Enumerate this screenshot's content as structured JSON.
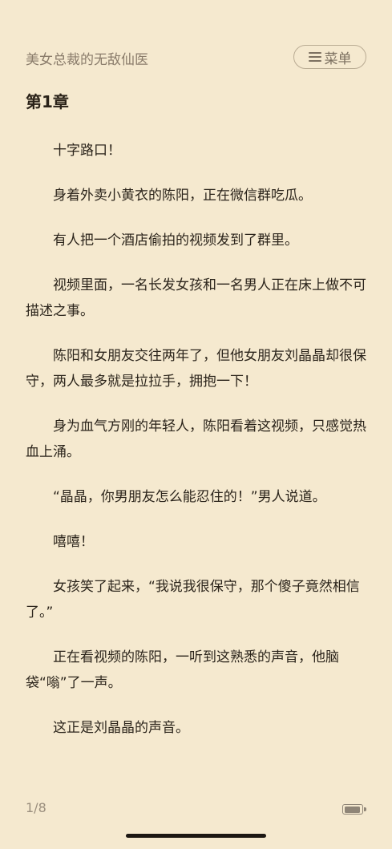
{
  "header": {
    "book_title": "美女总裁的无敌仙医",
    "menu_label": "菜单",
    "menu_icon": "list-menu-icon"
  },
  "chapter": {
    "title": "第1章"
  },
  "paragraphs": [
    "十字路口！",
    "身着外卖小黄衣的陈阳，正在微信群吃瓜。",
    "有人把一个酒店偷拍的视频发到了群里。",
    "视频里面，一名长发女孩和一名男人正在床上做不可描述之事。",
    "陈阳和女朋友交往两年了，但他女朋友刘晶晶却很保守，两人最多就是拉拉手，拥抱一下！",
    "身为血气方刚的年轻人，陈阳看着这视频，只感觉热血上涌。",
    "“晶晶，你男朋友怎么能忍住的！”男人说道。",
    "嘻嘻！",
    "女孩笑了起来，“我说我很保守，那个傻子竟然相信了。”",
    "正在看视频的陈阳，一听到这熟悉的声音，他脑袋“嗡”了一声。",
    "这正是刘晶晶的声音。"
  ],
  "footer": {
    "page_indicator": "1/8",
    "battery_level": 0.95,
    "battery_icon": "battery-icon"
  },
  "colors": {
    "background": "#f5e9cf",
    "text": "#2b241b",
    "muted": "#8a7c6b"
  }
}
